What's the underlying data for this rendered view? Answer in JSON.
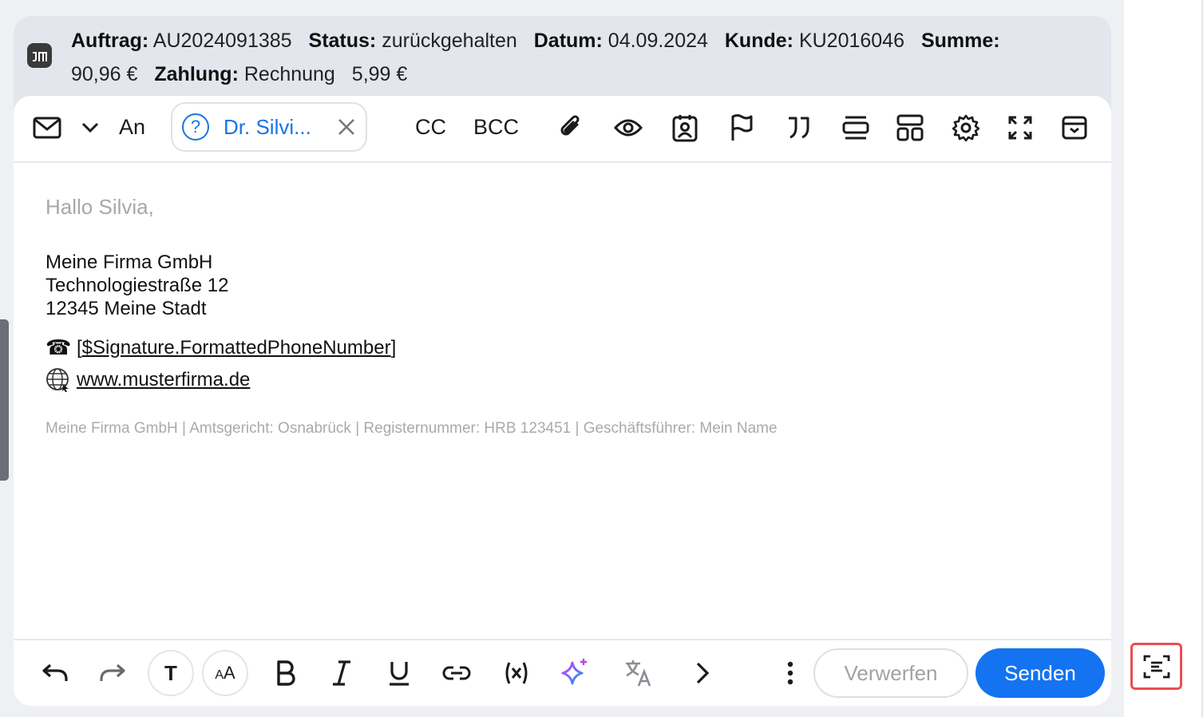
{
  "order": {
    "auftrag_label": "Auftrag:",
    "auftrag_value": "AU2024091385",
    "status_label": "Status:",
    "status_value": "zurückgehalten",
    "datum_label": "Datum:",
    "datum_value": "04.09.2024",
    "kunde_label": "Kunde:",
    "kunde_value": "KU2016046",
    "summe_label": "Summe:",
    "summe_value": "90,96 €",
    "zahlung_label": "Zahlung:",
    "zahlung_value": "Rechnung",
    "zahlung_amount": "5,99 €"
  },
  "composer": {
    "to_label": "An",
    "recipient_name": "Dr. Silvi...",
    "cc_label": "CC",
    "bcc_label": "BCC"
  },
  "body": {
    "greeting": "Hallo Silvia,",
    "signature_lines": [
      "Meine Firma GmbH",
      "Technologiestraße 12",
      "12345 Meine Stadt"
    ],
    "phone_icon": "☎",
    "phone_prefix": "[",
    "phone_placeholder": "$Signature.FormattedPhoneNumber",
    "phone_suffix": "]",
    "website": "www.musterfirma.de",
    "legal": "Meine Firma GmbH | Amtsgericht: Osnabrück | Registernummer: HRB 123451 | Geschäftsführer: Mein Name"
  },
  "actions": {
    "discard_label": "Verwerfen",
    "send_label": "Senden",
    "text_button": "T",
    "font_size_button": "AA"
  },
  "colors": {
    "accent": "#1473f0",
    "highlight_border": "#ea4e52"
  }
}
